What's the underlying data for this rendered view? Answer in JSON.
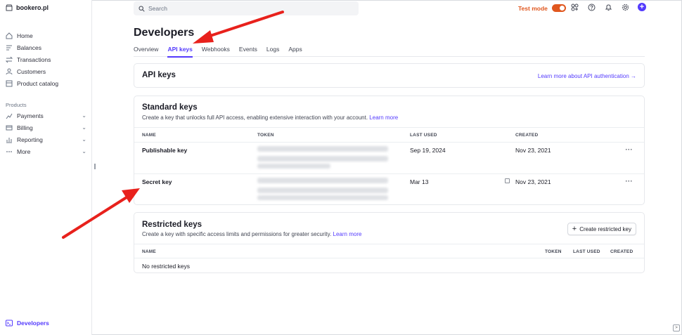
{
  "brand": {
    "name": "bookero.pl"
  },
  "sidebar": {
    "items": [
      {
        "label": "Home",
        "icon": "home-icon"
      },
      {
        "label": "Balances",
        "icon": "balances-icon"
      },
      {
        "label": "Transactions",
        "icon": "transactions-icon"
      },
      {
        "label": "Customers",
        "icon": "customers-icon"
      },
      {
        "label": "Product catalog",
        "icon": "product-catalog-icon"
      }
    ],
    "section_label": "Products",
    "products": [
      {
        "label": "Payments",
        "icon": "payments-icon",
        "chevron": "⌄"
      },
      {
        "label": "Billing",
        "icon": "billing-icon",
        "chevron": "⌄"
      },
      {
        "label": "Reporting",
        "icon": "reporting-icon",
        "chevron": "⌄"
      },
      {
        "label": "More",
        "icon": "more-icon",
        "chevron": "⌄"
      }
    ],
    "developers": "Developers"
  },
  "topbar": {
    "search_placeholder": "Search",
    "test_mode_label": "Test mode",
    "test_mode_on": true
  },
  "page": {
    "title": "Developers",
    "tabs": [
      "Overview",
      "API keys",
      "Webhooks",
      "Events",
      "Logs",
      "Apps"
    ],
    "active_tab": "API keys"
  },
  "api_keys_card": {
    "title": "API keys",
    "link": "Learn more about API authentication →"
  },
  "standard_keys": {
    "title": "Standard keys",
    "subtitle": "Create a key that unlocks full API access, enabling extensive interaction with your account.",
    "learn_more": "Learn more",
    "columns": [
      "NAME",
      "TOKEN",
      "LAST USED",
      "CREATED"
    ],
    "rows": [
      {
        "name": "Publishable key",
        "last_used": "Sep 19, 2024",
        "created": "Nov 23, 2021",
        "menu": "···"
      },
      {
        "name": "Secret key",
        "last_used": "Mar 13",
        "created": "Nov 23, 2021",
        "menu": "···"
      }
    ]
  },
  "restricted_keys": {
    "title": "Restricted keys",
    "subtitle": "Create a key with specific access limits and permissions for greater security.",
    "learn_more": "Learn more",
    "create_button": "Create restricted key",
    "columns": [
      "NAME",
      "TOKEN",
      "LAST USED",
      "CREATED"
    ],
    "empty": "No restricted keys"
  },
  "colors": {
    "accent": "#533afd",
    "test_mode": "#e0571f",
    "annotation_arrow": "#e8211c"
  }
}
